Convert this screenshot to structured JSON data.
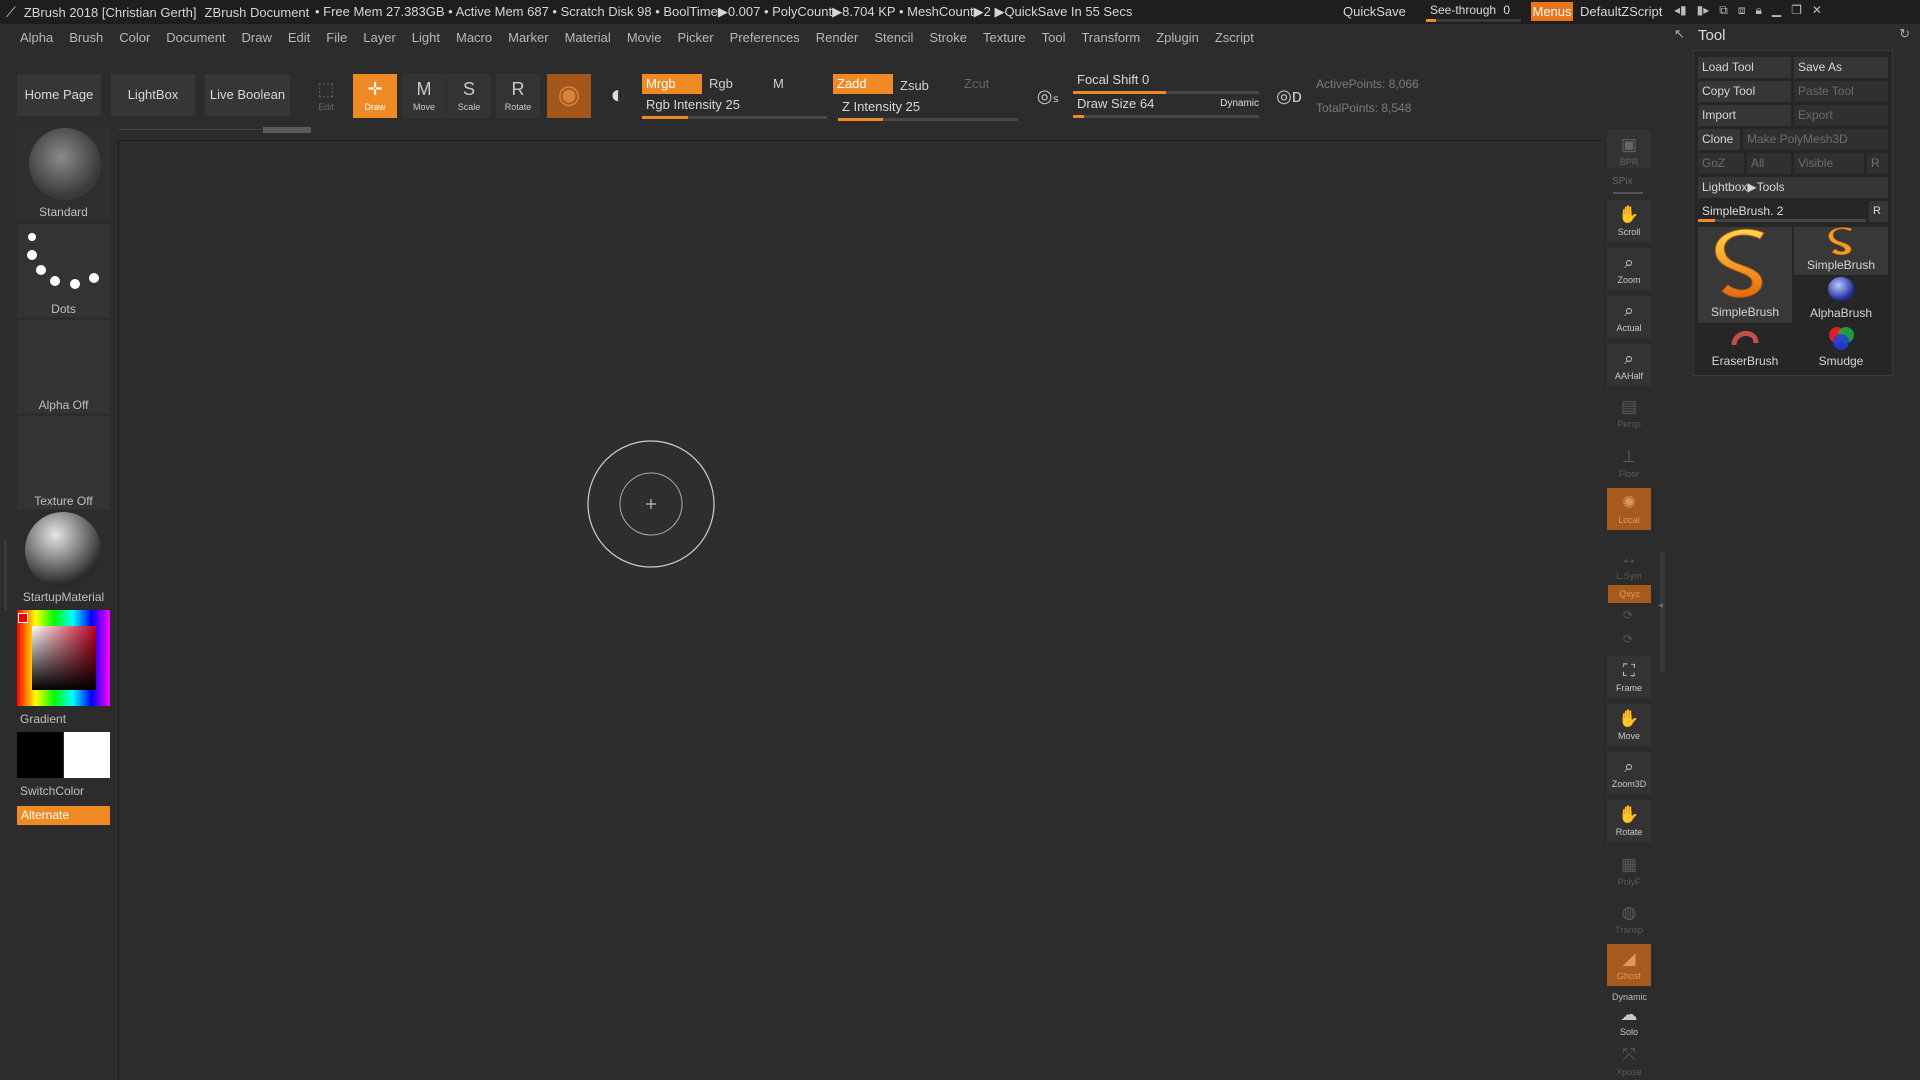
{
  "titlebar": {
    "app_title": "ZBrush 2018 [Christian Gerth]",
    "document": "ZBrush Document",
    "status": "• Free Mem 27.383GB • Active Mem 687 • Scratch Disk 98 • BoolTime▶0.007 • PolyCount▶8.704 KP • MeshCount▶2 ▶QuickSave In 55 Secs",
    "quicksave": "QuickSave",
    "seethrough_label": "See-through",
    "seethrough_value": "0",
    "seethrough_fraction": 0,
    "menus": "Menus",
    "default_zscript": "DefaultZScript"
  },
  "menus": [
    "Alpha",
    "Brush",
    "Color",
    "Document",
    "Draw",
    "Edit",
    "File",
    "Layer",
    "Light",
    "Macro",
    "Marker",
    "Material",
    "Movie",
    "Picker",
    "Preferences",
    "Render",
    "Stencil",
    "Stroke",
    "Texture",
    "Tool",
    "Transform",
    "Zplugin",
    "Zscript"
  ],
  "toolbar": {
    "home_page": "Home Page",
    "lightbox": "LightBox",
    "live_boolean": "Live Boolean",
    "edit": "Edit",
    "draw": "Draw",
    "move": "Move",
    "scale": "Scale",
    "rotate": "Rotate",
    "mrgb": "Mrgb",
    "rgb": "Rgb",
    "m": "M",
    "zadd": "Zadd",
    "zsub": "Zsub",
    "zcut": "Zcut",
    "rgb_intensity_label": "Rgb Intensity",
    "rgb_intensity": "25",
    "rgb_intensity_fraction": 0.25,
    "z_intensity_label": "Z Intensity",
    "z_intensity": "25",
    "z_intensity_fraction": 0.25,
    "focal_shift_label": "Focal Shift",
    "focal_shift": "0",
    "focal_shift_fraction": 0.5,
    "draw_size_label": "Draw Size",
    "draw_size": "64",
    "draw_size_fraction": 0.06,
    "dynamic": "Dynamic",
    "active_points": "ActivePoints: 8,066",
    "total_points": "TotalPoints: 8,548"
  },
  "left_shelf": {
    "brush": "Standard",
    "stroke": "Dots",
    "alpha": "Alpha Off",
    "texture": "Texture Off",
    "material": "StartupMaterial",
    "gradient": "Gradient",
    "switch_color": "SwitchColor",
    "alternate": "Alternate"
  },
  "right_shelf": {
    "bpr": "BPR",
    "spix": "SPix",
    "scroll": "Scroll",
    "zoom": "Zoom",
    "actual": "Actual",
    "aahalf": "AAHalf",
    "persp": "Persp",
    "floor": "Floor",
    "local": "Local",
    "lsym": "L.Sym",
    "xyz": "Qxyz",
    "frame": "Frame",
    "move": "Move",
    "zoom3d": "Zoom3D",
    "rotate": "Rotate",
    "polyf": "PolyF",
    "transp": "Transp",
    "ghost": "Ghost",
    "dynamic": "Dynamic",
    "solo": "Solo",
    "xpose": "Xpose"
  },
  "tool_panel": {
    "title": "Tool",
    "load_tool": "Load Tool",
    "save_as": "Save As",
    "copy_tool": "Copy Tool",
    "paste_tool": "Paste Tool",
    "import": "Import",
    "export": "Export",
    "clone": "Clone",
    "make_polymesh": "Make PolyMesh3D",
    "goz": "GoZ",
    "all": "All",
    "visible": "Visible",
    "r": "R",
    "lightbox_tools": "Lightbox▶Tools",
    "current_tool": "SimpleBrush. 2",
    "current_tool_fraction": 0.1,
    "brushes": [
      "SimpleBrush",
      "SimpleBrush",
      "AlphaBrush",
      "EraserBrush",
      "Smudge"
    ]
  },
  "colors": {
    "accent": "#f08a24",
    "background": "#2c2c2c",
    "primary_color": "#000000",
    "secondary_color": "#ffffff"
  }
}
